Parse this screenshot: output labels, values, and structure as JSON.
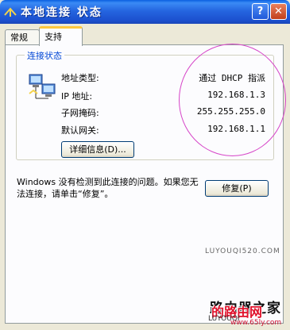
{
  "window": {
    "title": "本地连接 状态",
    "help_label": "?",
    "close_label": "✕"
  },
  "tabs": [
    {
      "label": "常规",
      "selected": false
    },
    {
      "label": "支持",
      "selected": true
    }
  ],
  "connection_status": {
    "group_label": "连接状态",
    "rows": [
      {
        "label": "地址类型:",
        "value": "通过 DHCP 指派"
      },
      {
        "label": "IP 地址:",
        "value": "192.168.1.3"
      },
      {
        "label": "子网掩码:",
        "value": "255.255.255.0"
      },
      {
        "label": "默认网关:",
        "value": "192.168.1.1"
      }
    ],
    "details_button": "详细信息(D)..."
  },
  "message": "Windows 没有检测到此连接的问题。如果您无法连接，请单击“修复”。",
  "repair_button": "修复(P)",
  "watermark": {
    "mid_text": "LUYOUQI520.COM",
    "main_text": "路由器之家",
    "red_text": "的路由网",
    "bottom_text": "LUYOUQI",
    "url": "www.65ly.com"
  },
  "colors": {
    "title_bar": "#2566e0",
    "group_label": "#0046d5",
    "annotation_ellipse": "#d645c8"
  }
}
